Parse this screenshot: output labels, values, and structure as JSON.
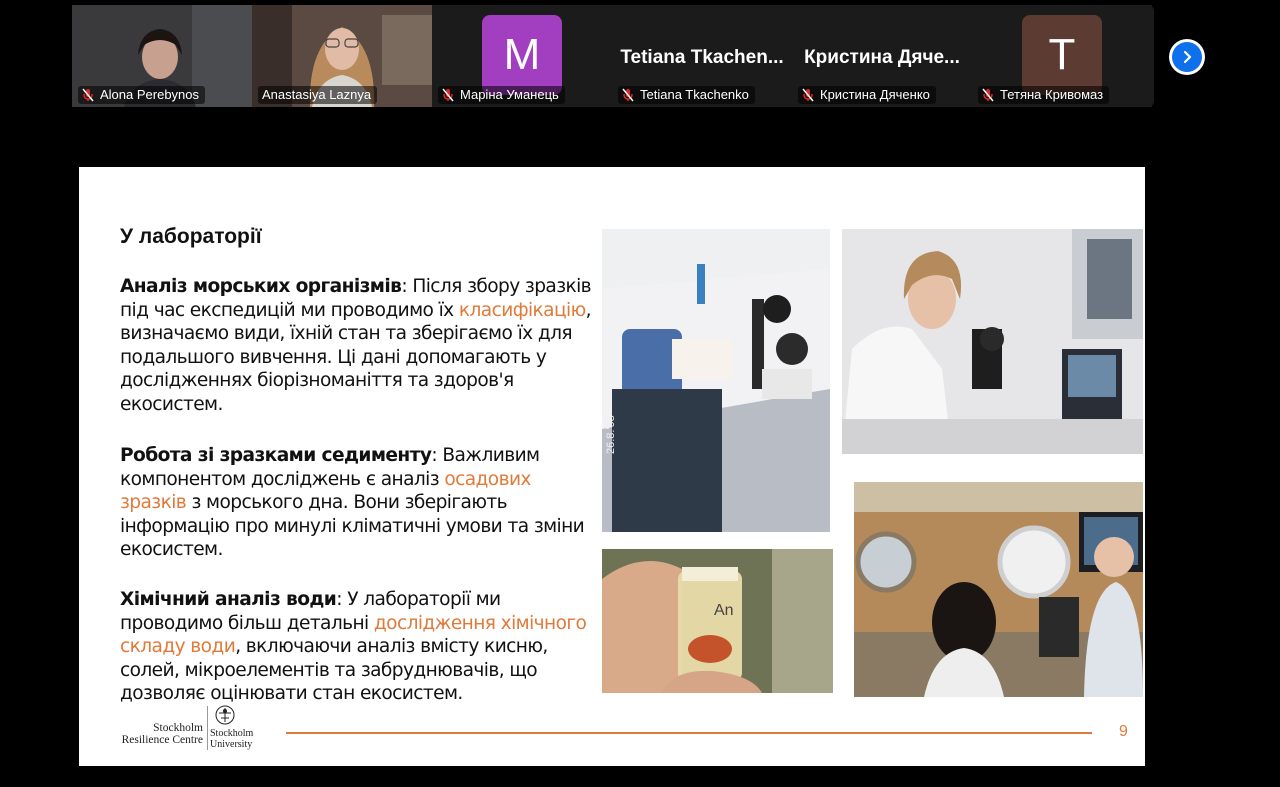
{
  "participants": [
    {
      "name": "Alona Perebynos",
      "type": "video"
    },
    {
      "name": "Anastasiya Laznya",
      "type": "video",
      "active": true
    },
    {
      "name": "Маріна Уманець",
      "type": "avatar",
      "initial": "M",
      "color": "#a23ec0"
    },
    {
      "name": "Tetiana Tkachenko",
      "type": "name",
      "display": "Tetiana  Tkachen..."
    },
    {
      "name": "Кристина Дяченко",
      "type": "name",
      "display": "Кристина  Дяче..."
    },
    {
      "name": "Тетяна Кривомаз",
      "type": "avatar",
      "initial": "T",
      "color": "#5b3b32"
    }
  ],
  "next_icon": "chevron-right-icon",
  "slide": {
    "title": "У лабораторії",
    "p1_head": "Аналіз морських організмів",
    "p1_a": ": Після збору зразків під час експедицій ми проводимо їх ",
    "p1_hl": "класифікацію",
    "p1_b": ", визначаємо види, їхній стан та зберігаємо їх для подальшого вивчення. Ці дані допомагають у дослідженнях біорізноманіття та здоров'я екосистем.",
    "p2_head": "Робота зі зразками седименту",
    "p2_a": ": Важливим компонентом досліджень є аналіз ",
    "p2_hl": "осадових зразків",
    "p2_b": " з морського дна. Вони зберігають інформацію про минулі кліматичні умови та зміни екосистем.",
    "p3_head": "Хімічний аналіз води",
    "p3_a": ": У лабораторії ми проводимо більш детальні ",
    "p3_hl": "дослідження хімічного складу води",
    "p3_b": ", включаючи аналіз вмісту кисню, солей, мікроелементів та забруднювачів, що дозволяє оцінювати стан екосистем.",
    "photo_text": "26.8.'98",
    "vial_label": "An",
    "footer_org1": "Stockholm",
    "footer_org2": "Resilience Centre",
    "footer_uni1": "Stockholm",
    "footer_uni2": "University",
    "page_number": "9",
    "accent": "#e07a3a"
  }
}
